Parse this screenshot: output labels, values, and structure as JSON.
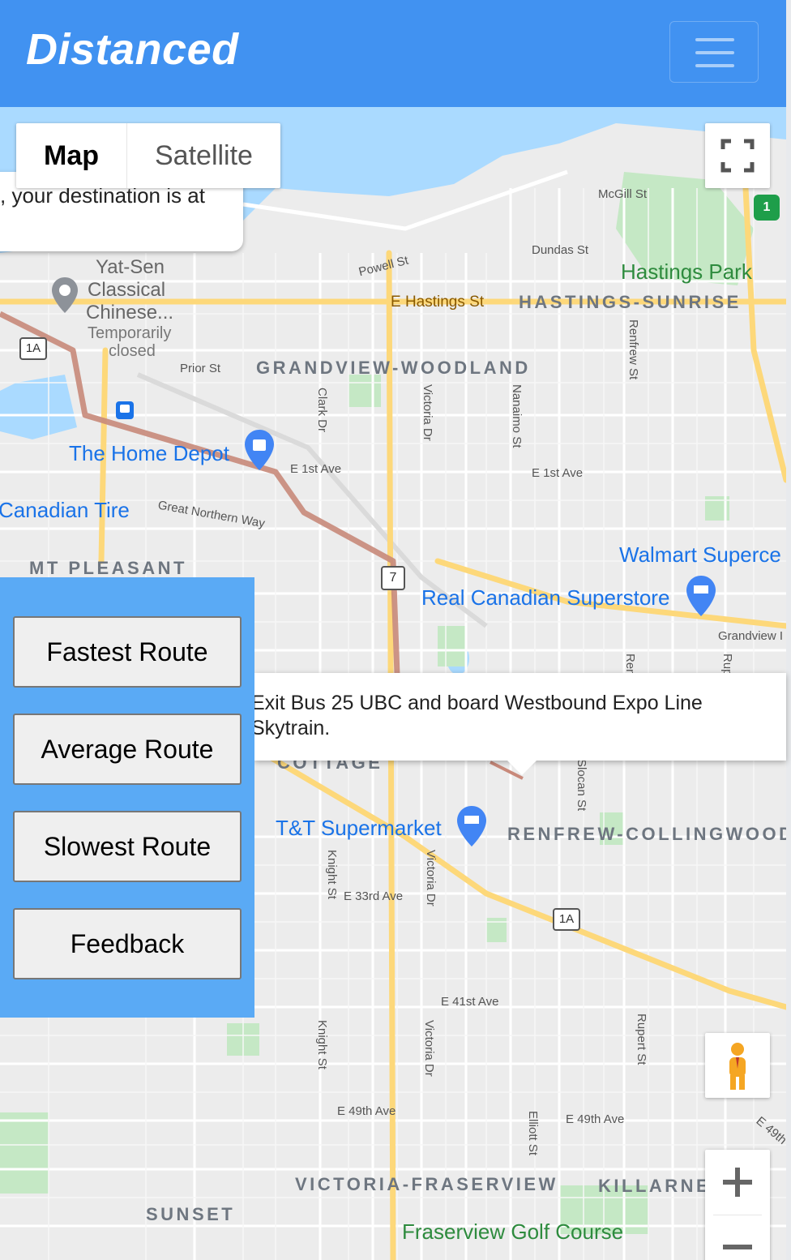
{
  "navbar": {
    "brand": "Distanced",
    "menu_icon": "hamburger-menu-icon"
  },
  "map_type": {
    "map_label": "Map",
    "satellite_label": "Satellite"
  },
  "info_top": {
    "text": ", your destination is at"
  },
  "directions": {
    "text": "Exit Bus 25 UBC and board Westbound Expo Line Skytrain."
  },
  "route_buttons": {
    "fastest": "Fastest Route",
    "average": "Average Route",
    "slowest": "Slowest Route",
    "feedback": "Feedback"
  },
  "map_labels": {
    "mcgill": "McGill St",
    "dundas": "Dundas St",
    "powell": "Powell St",
    "hastings": "E Hastings St",
    "hastings_sunrise": "HASTINGS-SUNRISE",
    "hastings_park": "Hastings Park",
    "grandview": "GRANDVIEW-WOODLAND",
    "prior": "Prior St",
    "clark": "Clark Dr",
    "victoria1": "Victoria Dr",
    "nanaimo": "Nanaimo St",
    "renfrew": "Renfrew St",
    "e1st_a": "E 1st Ave",
    "e1st_b": "E 1st Ave",
    "home_depot": "The Home Depot",
    "canadian_tire": "Canadian Tire",
    "great_northern": "Great Northern Way",
    "mt_pleasant": "MT PLEASANT",
    "walmart": "Walmart Superce",
    "real_canadian": "Real Canadian Superstore",
    "grandview_hwy": "Grandview I",
    "ren_short": "Ren",
    "rup_short": "Rup",
    "yat_sen_1": "Yat-Sen",
    "yat_sen_2": "Classical",
    "yat_sen_3": "Chinese...",
    "temp_1": "Temporarily",
    "temp_2": "closed",
    "cottage": "COTTAGE",
    "tt": "T&T Supermarket",
    "renfrew_collingwood": "RENFREW-COLLINGWOOD",
    "knight1": "Knight St",
    "e33rd": "E 33rd Ave",
    "victoria2": "Victoria Dr",
    "slocan": "Slocan St",
    "e41st": "E 41st Ave",
    "knight2": "Knight St",
    "victoria3": "Victoria Dr",
    "rupert": "Rupert St",
    "e49th_a": "E 49th Ave",
    "e49th_b": "E 49th Ave",
    "e49th_c": "E 49th",
    "elliott": "Elliott St",
    "victoria_fraserview": "VICTORIA-FRASERVIEW",
    "killarney": "KILLARNE",
    "sunset": "SUNSET",
    "fraserview": "Fraserview Golf Course",
    "shield_1a_a": "1A",
    "shield_1a_b": "1A",
    "shield_7": "7",
    "shield_1": "1"
  },
  "colors": {
    "navbar": "#4192f1",
    "panel": "#5aaaf5",
    "route": "#c8897a",
    "water": "#aadaff",
    "park": "#c5e8c5",
    "highway": "#fdd87a"
  }
}
